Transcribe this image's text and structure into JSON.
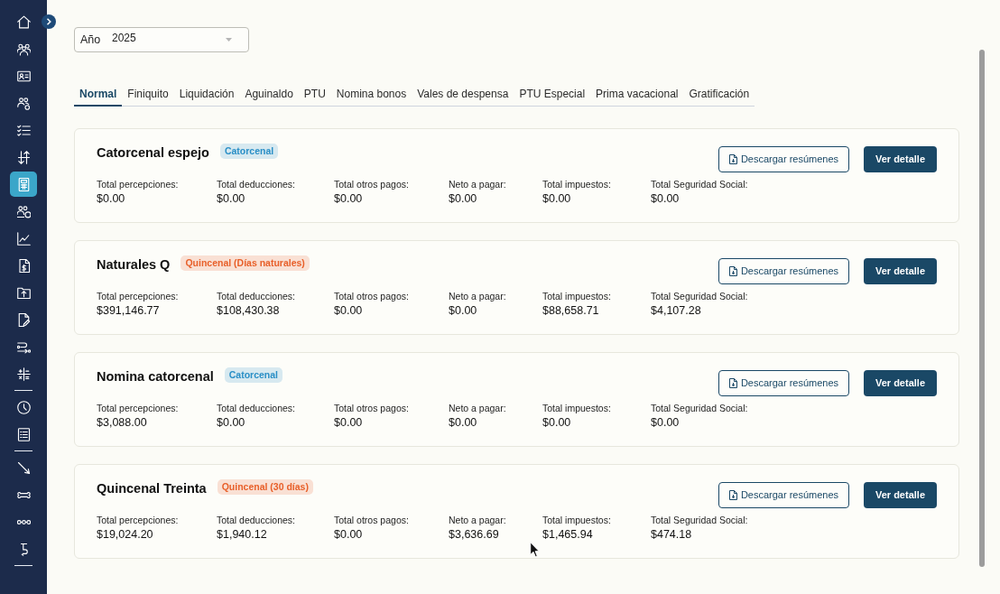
{
  "sidebar": {
    "groups": [
      {
        "items": [
          {
            "selected": false
          },
          {
            "selected": false
          },
          {
            "selected": false
          },
          {
            "selected": false
          },
          {
            "selected": false
          },
          {
            "selected": false
          },
          {
            "selected": true
          },
          {
            "selected": false
          },
          {
            "selected": false
          },
          {
            "selected": false
          },
          {
            "selected": false
          },
          {
            "selected": false
          },
          {
            "selected": false
          },
          {
            "selected": false
          }
        ]
      },
      {
        "items": [
          {
            "selected": false
          },
          {
            "selected": false
          }
        ]
      },
      {
        "items": [
          {
            "selected": false
          },
          {
            "selected": false
          },
          {
            "selected": false
          },
          {
            "selected": false
          }
        ]
      }
    ]
  },
  "year_filter": {
    "label": "Año",
    "value": "2025"
  },
  "tabs": [
    {
      "label": "Normal",
      "selected": true
    },
    {
      "label": "Finiquito",
      "selected": false
    },
    {
      "label": "Liquidación",
      "selected": false
    },
    {
      "label": "Aguinaldo",
      "selected": false
    },
    {
      "label": "PTU",
      "selected": false
    },
    {
      "label": "Nomina bonos",
      "selected": false
    },
    {
      "label": "Vales de despensa",
      "selected": false
    },
    {
      "label": "PTU Especial",
      "selected": false
    },
    {
      "label": "Prima vacacional",
      "selected": false
    },
    {
      "label": "Gratificación",
      "selected": false
    }
  ],
  "cards": [
    {
      "title": "Catorcenal espejo",
      "badge": {
        "text": "Catorcenal",
        "color": "#2a8fc6"
      },
      "download_button": "Descargar resúmenes",
      "detail_button": "Ver detalle",
      "stats": [
        {
          "label": "Total percepciones:",
          "value": "$0.00"
        },
        {
          "label": "Total deducciones:",
          "value": "$0.00"
        },
        {
          "label": "Total otros pagos:",
          "value": "$0.00"
        },
        {
          "label": "Neto a pagar:",
          "value": "$0.00"
        },
        {
          "label": "Total impuestos:",
          "value": "$0.00"
        },
        {
          "label": "Total Seguridad Social:",
          "value": "$0.00"
        }
      ]
    },
    {
      "title": "Naturales Q",
      "badge": {
        "text": "Quincenal (Días naturales)",
        "color": "#e8602a"
      },
      "download_button": "Descargar resúmenes",
      "detail_button": "Ver detalle",
      "stats": [
        {
          "label": "Total percepciones:",
          "value": "$391,146.77"
        },
        {
          "label": "Total deducciones:",
          "value": "$108,430.38"
        },
        {
          "label": "Total otros pagos:",
          "value": "$0.00"
        },
        {
          "label": "Neto a pagar:",
          "value": "$0.00"
        },
        {
          "label": "Total impuestos:",
          "value": "$88,658.71"
        },
        {
          "label": "Total Seguridad Social:",
          "value": "$4,107.28"
        }
      ]
    },
    {
      "title": "Nomina catorcenal",
      "badge": {
        "text": "Catorcenal",
        "color": "#2a8fc6"
      },
      "download_button": "Descargar resúmenes",
      "detail_button": "Ver detalle",
      "stats": [
        {
          "label": "Total percepciones:",
          "value": "$3,088.00"
        },
        {
          "label": "Total deducciones:",
          "value": "$0.00"
        },
        {
          "label": "Total otros pagos:",
          "value": "$0.00"
        },
        {
          "label": "Neto a pagar:",
          "value": "$0.00"
        },
        {
          "label": "Total impuestos:",
          "value": "$0.00"
        },
        {
          "label": "Total Seguridad Social:",
          "value": "$0.00"
        }
      ]
    },
    {
      "title": "Quincenal Treinta",
      "badge": {
        "text": "Quincenal (30 días)",
        "color": "#e8602a"
      },
      "download_button": "Descargar resúmenes",
      "detail_button": "Ver detalle",
      "stats": [
        {
          "label": "Total percepciones:",
          "value": "$19,024.20"
        },
        {
          "label": "Total deducciones:",
          "value": "$1,940.12"
        },
        {
          "label": "Total otros pagos:",
          "value": "$0.00"
        },
        {
          "label": "Neto a pagar:",
          "value": "$3,636.69"
        },
        {
          "label": "Total impuestos:",
          "value": "$1,465.94"
        },
        {
          "label": "Total Seguridad Social:",
          "value": "$474.18"
        }
      ]
    }
  ]
}
